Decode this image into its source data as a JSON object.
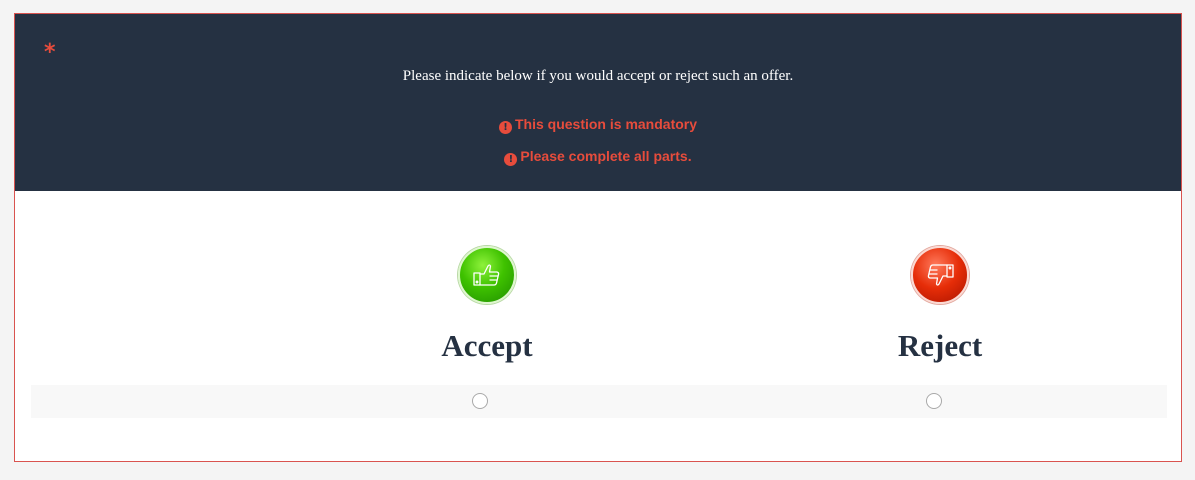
{
  "question": {
    "required_marker": "*",
    "text": "Please indicate below if you would accept or reject such an offer.",
    "errors": [
      {
        "icon": "exclamation-circle-icon",
        "text": "This question is mandatory"
      },
      {
        "icon": "exclamation-circle-icon",
        "text": "Please complete all parts."
      }
    ]
  },
  "options": [
    {
      "label": "Accept",
      "icon": "thumbs-up-icon",
      "color": "#3fc200",
      "selected": false
    },
    {
      "label": "Reject",
      "icon": "thumbs-down-icon",
      "color": "#e62d08",
      "selected": false
    }
  ],
  "colors": {
    "header_bg": "#253142",
    "error": "#e74c3c",
    "card_border": "#d9534f"
  }
}
